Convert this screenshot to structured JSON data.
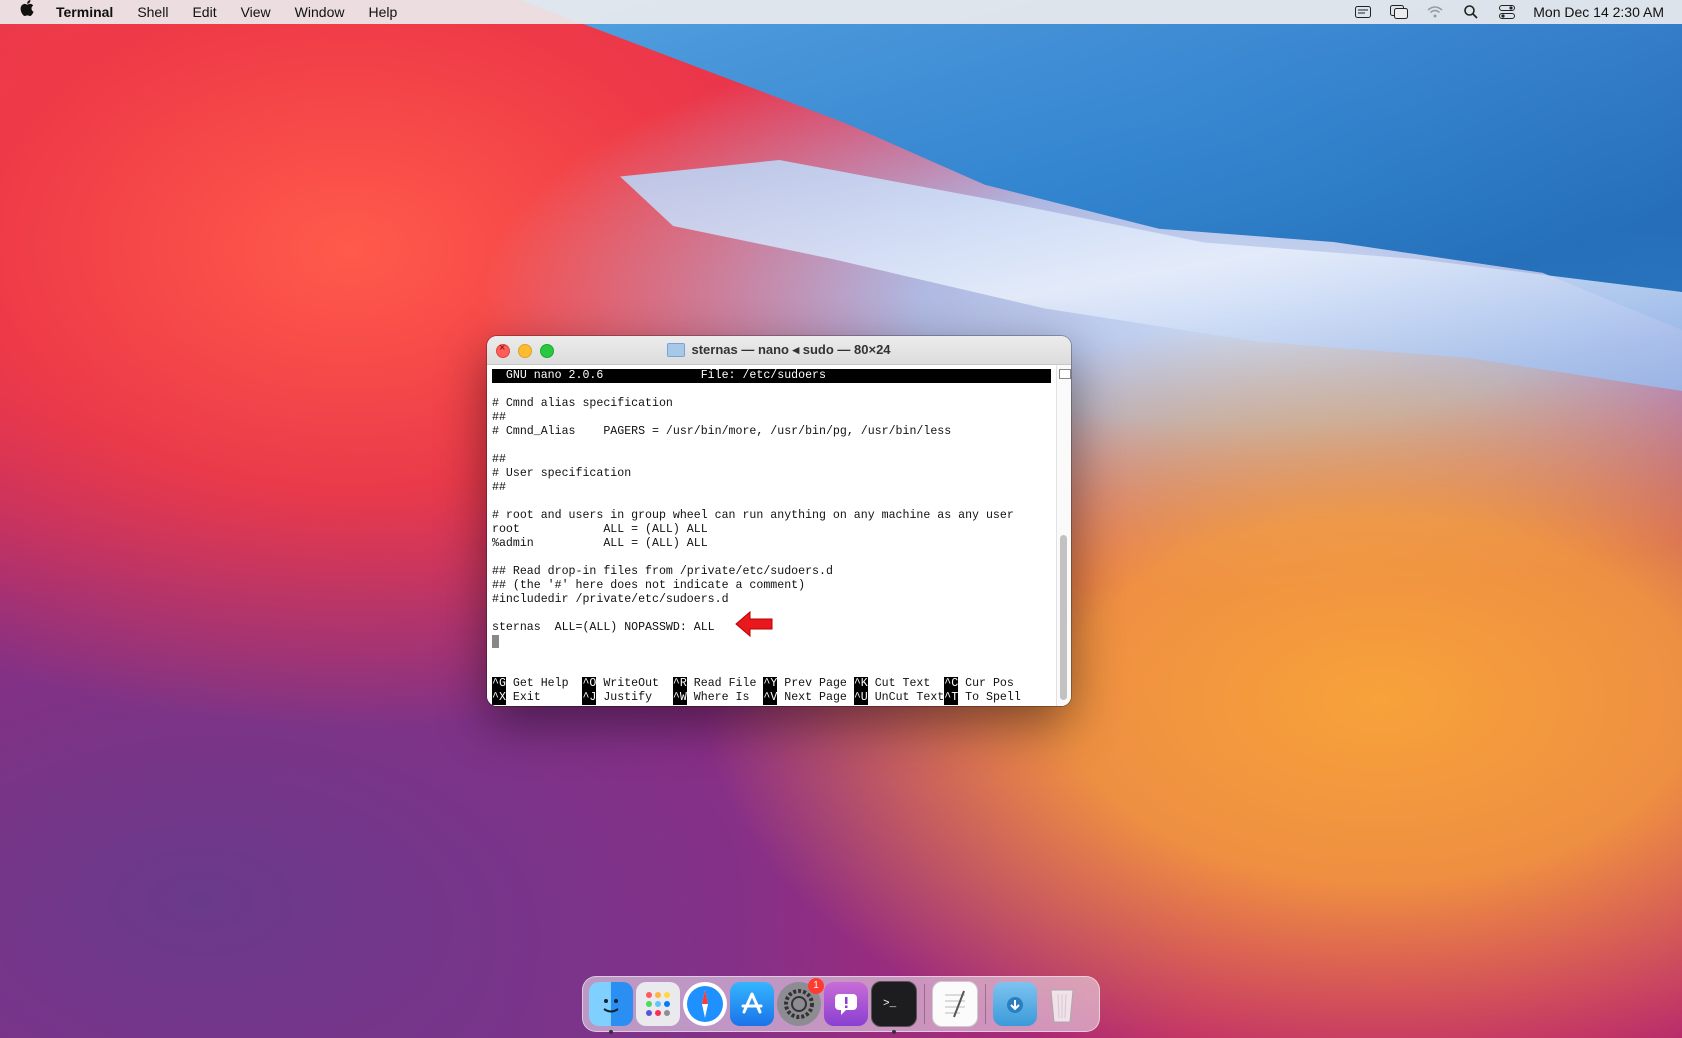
{
  "menubar": {
    "app": "Terminal",
    "menus": [
      "Shell",
      "Edit",
      "View",
      "Window",
      "Help"
    ],
    "clock": "Mon Dec 14  2:30 AM"
  },
  "window": {
    "title": "sternas — nano ◂ sudo — 80×24"
  },
  "nano": {
    "header": "  GNU nano 2.0.6              File: /etc/sudoers",
    "lines": [
      "",
      "# Cmnd alias specification",
      "##",
      "# Cmnd_Alias    PAGERS = /usr/bin/more, /usr/bin/pg, /usr/bin/less",
      "",
      "##",
      "# User specification",
      "##",
      "",
      "# root and users in group wheel can run anything on any machine as any user",
      "root            ALL = (ALL) ALL",
      "%admin          ALL = (ALL) ALL",
      "",
      "## Read drop-in files from /private/etc/sudoers.d",
      "## (the '#' here does not indicate a comment)",
      "#includedir /private/etc/sudoers.d",
      "",
      "sternas  ALL=(ALL) NOPASSWD: ALL"
    ],
    "shortcuts_row1": [
      {
        "key": "^G",
        "label": " Get Help  "
      },
      {
        "key": "^O",
        "label": " WriteOut  "
      },
      {
        "key": "^R",
        "label": " Read File "
      },
      {
        "key": "^Y",
        "label": " Prev Page "
      },
      {
        "key": "^K",
        "label": " Cut Text  "
      },
      {
        "key": "^C",
        "label": " Cur Pos"
      }
    ],
    "shortcuts_row2": [
      {
        "key": "^X",
        "label": " Exit      "
      },
      {
        "key": "^J",
        "label": " Justify   "
      },
      {
        "key": "^W",
        "label": " Where Is  "
      },
      {
        "key": "^V",
        "label": " Next Page "
      },
      {
        "key": "^U",
        "label": " UnCut Text"
      },
      {
        "key": "^T",
        "label": " To Spell"
      }
    ]
  },
  "dock": {
    "apps": [
      "finder-icon",
      "launchpad-icon",
      "safari-icon",
      "app-store-icon",
      "system-preferences-icon",
      "feedback-assistant-icon",
      "terminal-icon",
      "textedit-icon",
      "downloads-icon",
      "trash-icon"
    ],
    "system_preferences_badge": "1"
  },
  "colors": {
    "arrow": "#e8191c",
    "nano_header_bg": "#000000"
  }
}
